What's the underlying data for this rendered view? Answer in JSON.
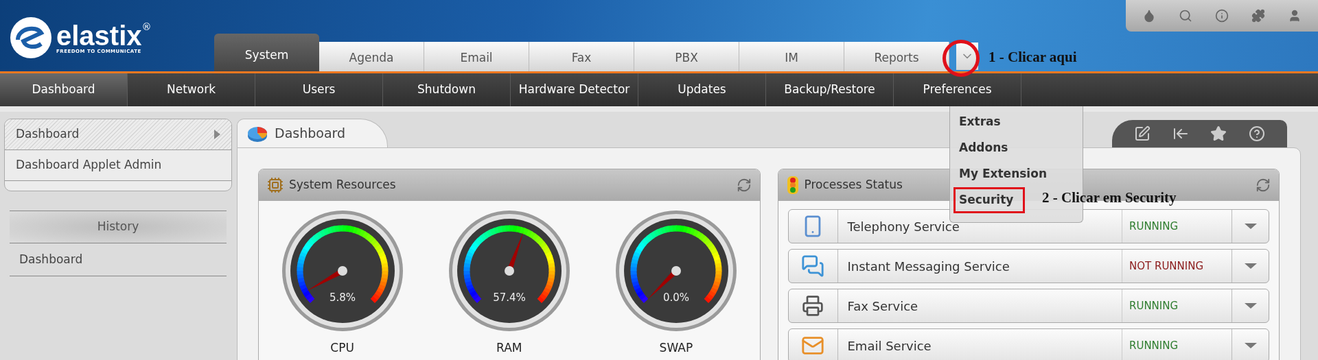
{
  "header": {
    "logo": {
      "name": "elastix",
      "registered": "®",
      "tagline": "FREEDOM TO COMMUNICATE"
    }
  },
  "tabs": [
    {
      "label": "System",
      "selected": true
    },
    {
      "label": "Agenda",
      "selected": false
    },
    {
      "label": "Email",
      "selected": false
    },
    {
      "label": "Fax",
      "selected": false
    },
    {
      "label": "PBX",
      "selected": false
    },
    {
      "label": "IM",
      "selected": false
    },
    {
      "label": "Reports",
      "selected": false
    }
  ],
  "submenu": [
    {
      "label": "Dashboard",
      "selected": true
    },
    {
      "label": "Network",
      "selected": false
    },
    {
      "label": "Users",
      "selected": false
    },
    {
      "label": "Shutdown",
      "selected": false
    },
    {
      "label": "Hardware Detector",
      "selected": false
    },
    {
      "label": "Updates",
      "selected": false
    },
    {
      "label": "Backup/Restore",
      "selected": false
    },
    {
      "label": "Preferences",
      "selected": false
    }
  ],
  "dropdown": {
    "items": [
      {
        "label": "Extras",
        "marked": false
      },
      {
        "label": "Addons",
        "marked": false
      },
      {
        "label": "My Extension",
        "marked": false
      },
      {
        "label": "Security",
        "marked": true
      }
    ]
  },
  "annotations": [
    {
      "text": "1 - Clicar aqui"
    },
    {
      "text": "2 - Clicar em Security"
    }
  ],
  "sidebar": {
    "items": [
      {
        "label": "Dashboard",
        "selected": true
      },
      {
        "label": "Dashboard Applet Admin",
        "selected": false
      }
    ],
    "history": {
      "title": "History",
      "items": [
        "Dashboard"
      ]
    }
  },
  "content": {
    "tab": "Dashboard",
    "system_resources": {
      "title": "System Resources",
      "gauges": [
        {
          "label": "CPU",
          "reading": "5.8%"
        },
        {
          "label": "RAM",
          "reading": "57.4%"
        },
        {
          "label": "SWAP",
          "reading": "0.0%"
        }
      ]
    },
    "processes": {
      "title": "Processes Status",
      "services": [
        {
          "kind": "phone",
          "name": "Telephony Service",
          "status": "RUNNING",
          "running": true
        },
        {
          "kind": "chat",
          "name": "Instant Messaging Service",
          "status": "NOT RUNNING",
          "running": false
        },
        {
          "kind": "fax",
          "name": "Fax Service",
          "status": "RUNNING",
          "running": true
        },
        {
          "kind": "mail",
          "name": "Email Service",
          "status": "RUNNING",
          "running": true
        }
      ]
    }
  }
}
